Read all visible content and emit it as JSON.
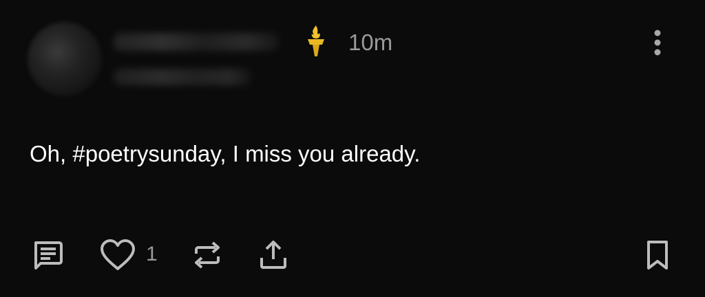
{
  "post": {
    "author_avatar": "avatar-blurred",
    "author_name": "",
    "author_handle": "",
    "badge_icon": "torch-icon",
    "timestamp": "10m",
    "content": "Oh, #poetrysunday, I miss you already.",
    "menu_icon": "more-vertical-icon"
  },
  "actions": {
    "reply_icon": "reply-icon",
    "like_icon": "heart-icon",
    "like_count": "1",
    "boost_icon": "repost-icon",
    "share_icon": "share-icon",
    "bookmark_icon": "bookmark-icon"
  },
  "colors": {
    "background": "#0b0b0c",
    "text_primary": "#ffffff",
    "text_secondary": "#9a9a9a",
    "icon": "#bdbdbd",
    "torch_gold": "#e8b923"
  }
}
